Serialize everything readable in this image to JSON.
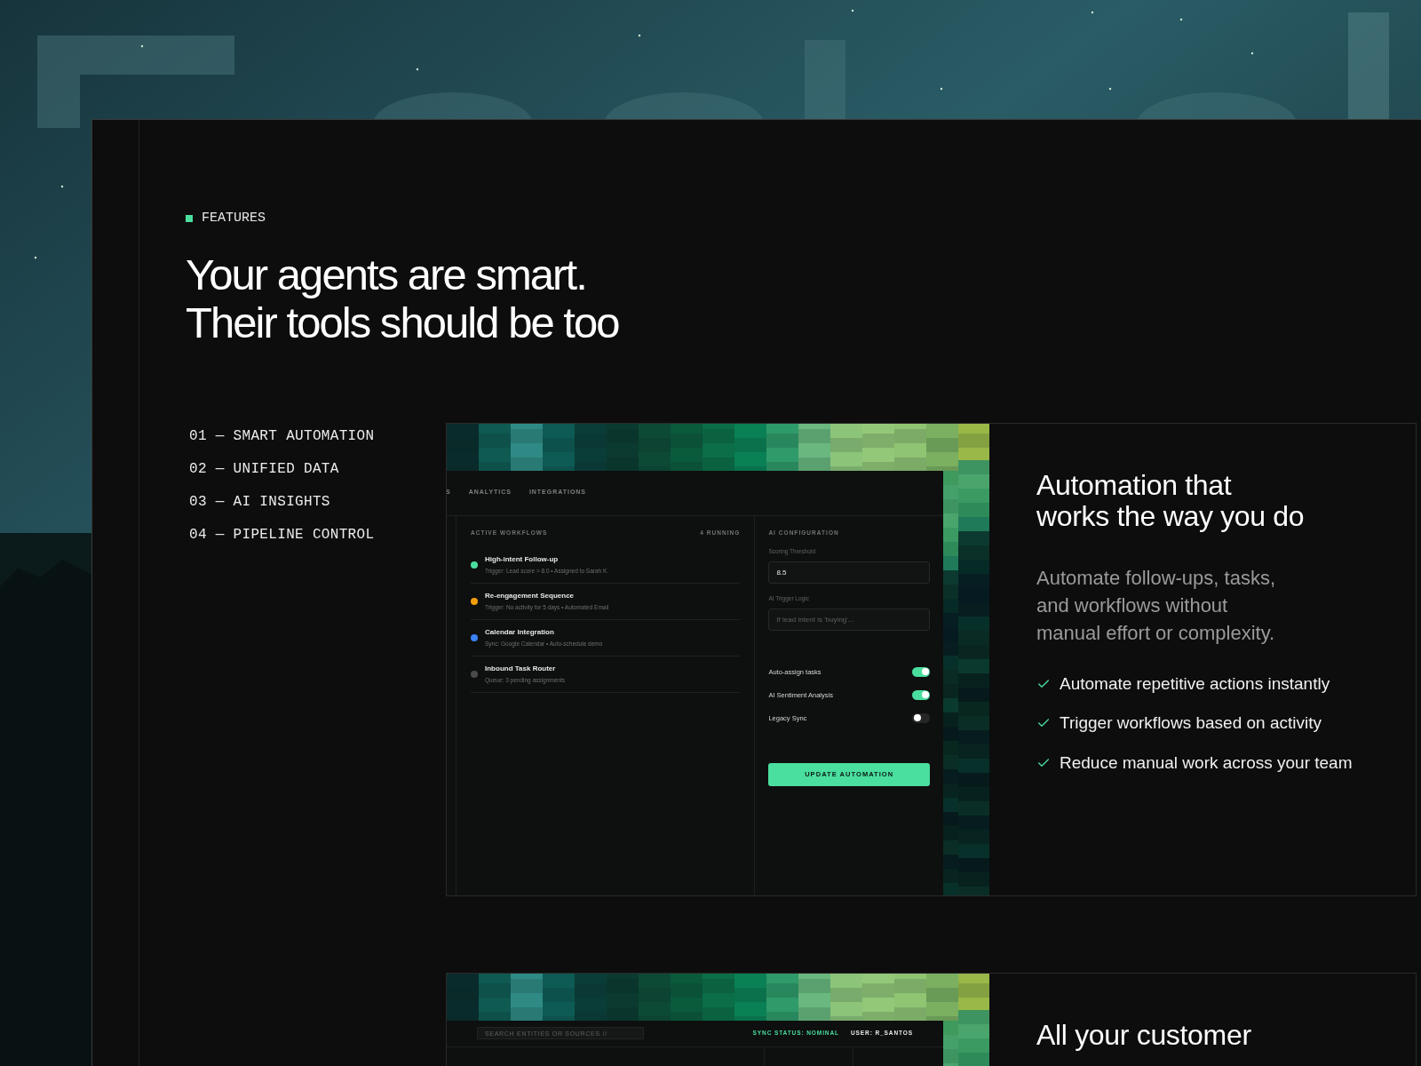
{
  "section_label": "FEATURES",
  "heading_lines": [
    "Your agents are smart.",
    "Their tools should be too"
  ],
  "feature_nav": [
    {
      "label": "01 — SMART AUTOMATION"
    },
    {
      "label": "02 — UNIFIED DATA"
    },
    {
      "label": "03 — AI INSIGHTS"
    },
    {
      "label": "04 — PIPELINE CONTROL"
    }
  ],
  "features": [
    {
      "mockup": {
        "kind": "automation",
        "tabs": [
          "S",
          "ANALYTICS",
          "INTEGRATIONS"
        ],
        "workflows": {
          "title": "ACTIVE WORKFLOWS",
          "count": "4 RUNNING",
          "items": [
            {
              "title": "High-intent Follow-up",
              "detail": "Trigger: Lead score > 8.0 • Assigned to Sarah K.",
              "color": "#4ade9f"
            },
            {
              "title": "Re-engagement Sequence",
              "detail": "Trigger: No activity for 5 days • Automated Email",
              "color": "#f59e0b"
            },
            {
              "title": "Calendar Integration",
              "detail": "Sync: Google Calendar • Auto-schedule demo",
              "color": "#3b82f6"
            },
            {
              "title": "Inbound Task Router",
              "detail": "Queue: 3 pending assignments",
              "color": "#4a4a4a"
            }
          ]
        },
        "config": {
          "title": "AI CONFIGURATION",
          "fields": [
            {
              "label": "Scoring Threshold",
              "value": "8.5"
            },
            {
              "label": "AI Trigger Logic",
              "placeholder": "If lead intent is 'buying'..."
            }
          ],
          "toggles": [
            {
              "label": "Auto-assign tasks",
              "on": true
            },
            {
              "label": "AI Sentiment Analysis",
              "on": true
            },
            {
              "label": "Legacy Sync",
              "on": false
            }
          ],
          "button": "UPDATE AUTOMATION"
        }
      },
      "title_lines": [
        "Automation that",
        "works the way you do"
      ],
      "description": "Automate follow-ups, tasks, and workflows without manual effort or complexity.",
      "points": [
        "Automate repetitive actions instantly",
        "Trigger workflows based on activity",
        "Reduce manual work across your team"
      ]
    },
    {
      "mockup": {
        "kind": "data",
        "search_placeholder": "SEARCH ENTITIES OR SOURCES //",
        "sync_status": "SYNC STATUS: NOMINAL",
        "user": "USER: R_SANTOS"
      },
      "title_lines": [
        "All your customer"
      ]
    }
  ]
}
